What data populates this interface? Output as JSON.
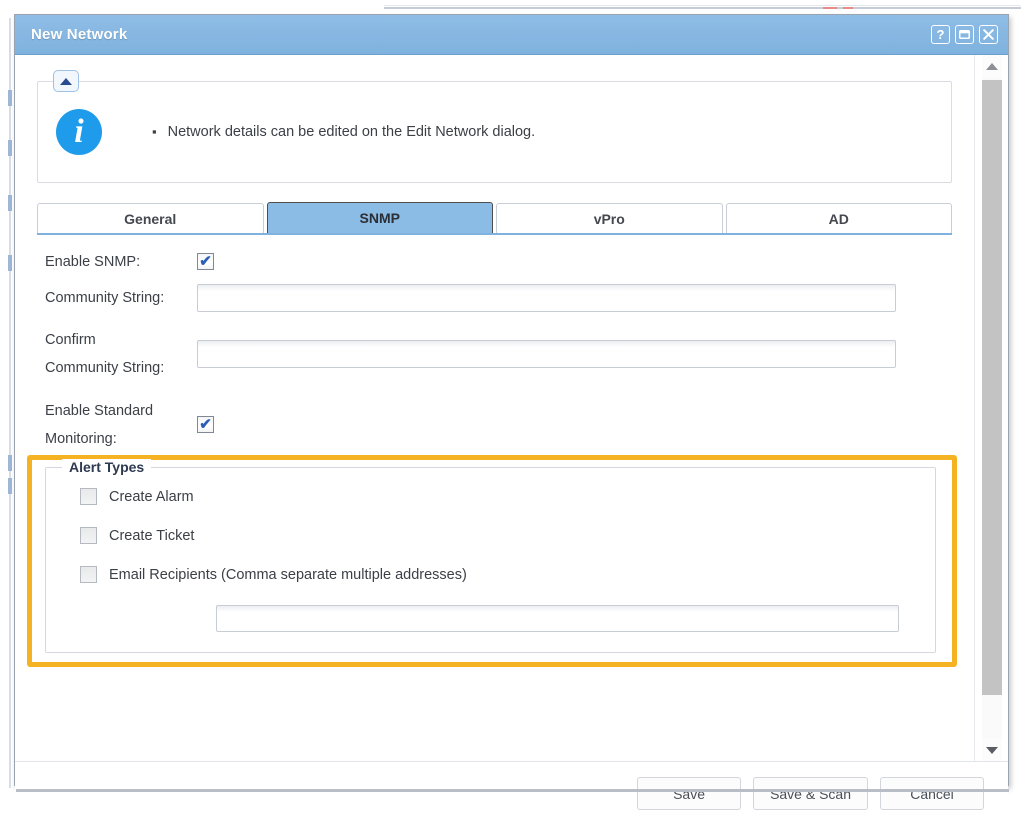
{
  "window": {
    "title": "New Network",
    "controls": [
      {
        "name": "help-button",
        "glyph": "?"
      },
      {
        "name": "restore-button",
        "glyph": "▭"
      },
      {
        "name": "close-button",
        "glyph": "✕"
      }
    ]
  },
  "info_panel": {
    "collapse_toggle": "▲",
    "icon": "info-circle-icon",
    "icon_glyph": "i",
    "bullet": "▪",
    "message": "Network details can be edited on the Edit Network dialog."
  },
  "tabs": [
    {
      "label": "General",
      "active": false
    },
    {
      "label": "SNMP",
      "active": true
    },
    {
      "label": "vPro",
      "active": false
    },
    {
      "label": "AD",
      "active": false
    }
  ],
  "form": {
    "enable_snmp": {
      "label": "Enable SNMP:",
      "checked": true,
      "check_glyph": "✔"
    },
    "community_string": {
      "label": "Community String:",
      "value": "",
      "placeholder": ""
    },
    "confirm_community_string": {
      "label_line1": "Confirm",
      "label_line2": "Community String:",
      "value": "",
      "placeholder": ""
    },
    "enable_standard_monitoring": {
      "label_line1": "Enable Standard",
      "label_line2": "Monitoring:",
      "checked": true,
      "check_glyph": "✔"
    }
  },
  "alert_types": {
    "legend": "Alert Types",
    "highlight_color": "#f5b324",
    "items": [
      {
        "label": "Create Alarm",
        "checked": false
      },
      {
        "label": "Create Ticket",
        "checked": false
      },
      {
        "label": "Email Recipients (Comma separate multiple addresses)",
        "checked": false
      }
    ],
    "email_input": {
      "value": "",
      "placeholder": ""
    }
  },
  "scrollbar": {
    "up_arrow": "▲",
    "down_arrow": "▼"
  },
  "footer": {
    "save_label": "Save",
    "save_scan_label": "Save & Scan",
    "cancel_label": "Cancel"
  },
  "colors": {
    "titlebar": "#85b7e2",
    "active_tab": "#8bbce5",
    "info_icon": "#1e9ceb",
    "highlight": "#f5b324",
    "checkmark": "#2b5fb5"
  }
}
